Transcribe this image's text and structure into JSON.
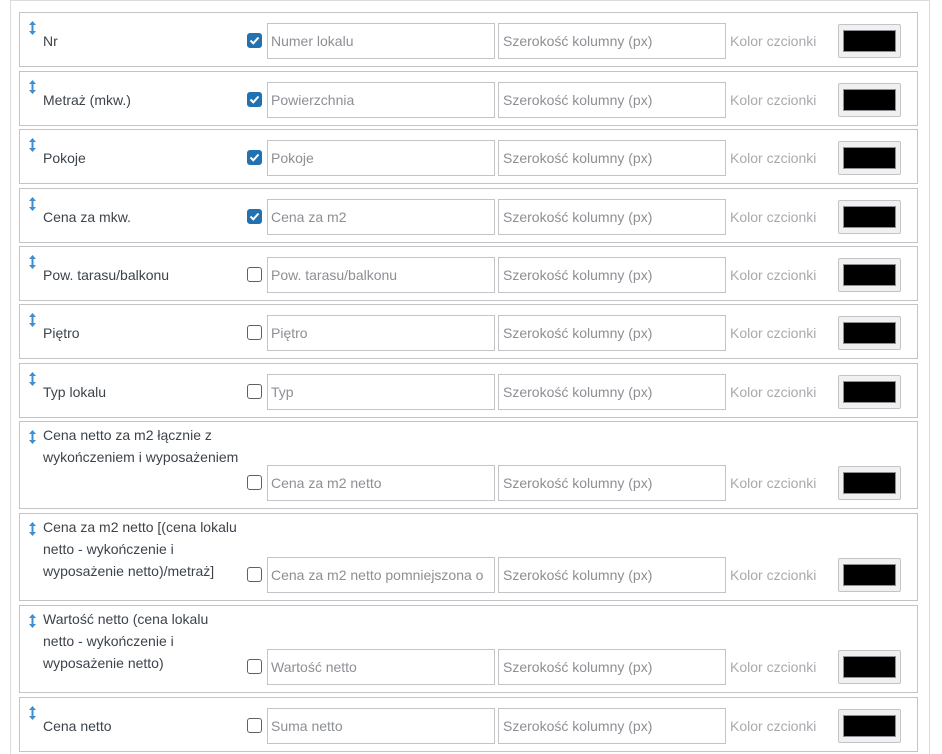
{
  "columns": {
    "width_placeholder": "Szerokość kolumny (px)",
    "font_color_label": "Kolor czcionki",
    "swatch_color": "#000000"
  },
  "rows": [
    {
      "label": "Nr",
      "checked": true,
      "name_value": "Numer lokalu"
    },
    {
      "label": "Metraż (mkw.)",
      "checked": true,
      "name_value": "Powierzchnia"
    },
    {
      "label": "Pokoje",
      "checked": true,
      "name_value": "Pokoje"
    },
    {
      "label": "Cena za mkw.",
      "checked": true,
      "name_value": "Cena za m2"
    },
    {
      "label": "Pow. tarasu/balkonu",
      "checked": false,
      "name_value": "Pow. tarasu/balkonu"
    },
    {
      "label": "Piętro",
      "checked": false,
      "name_value": "Piętro"
    },
    {
      "label": "Typ lokalu",
      "checked": false,
      "name_value": "Typ"
    },
    {
      "label": "Cena netto za m2 łącznie z wykończeniem i wyposażeniem",
      "checked": false,
      "name_value": "Cena za m2 netto"
    },
    {
      "label": "Cena za m2 netto [(cena lokalu netto - wykończenie i wyposażenie netto)/metraż]",
      "checked": false,
      "name_value": "Cena za m2 netto pomniejszona o"
    },
    {
      "label": "Wartość netto (cena lokalu netto - wykończenie i wyposażenie netto)",
      "checked": false,
      "name_value": "Wartość netto"
    },
    {
      "label": "Cena netto",
      "checked": false,
      "name_value": "Suma netto"
    }
  ]
}
